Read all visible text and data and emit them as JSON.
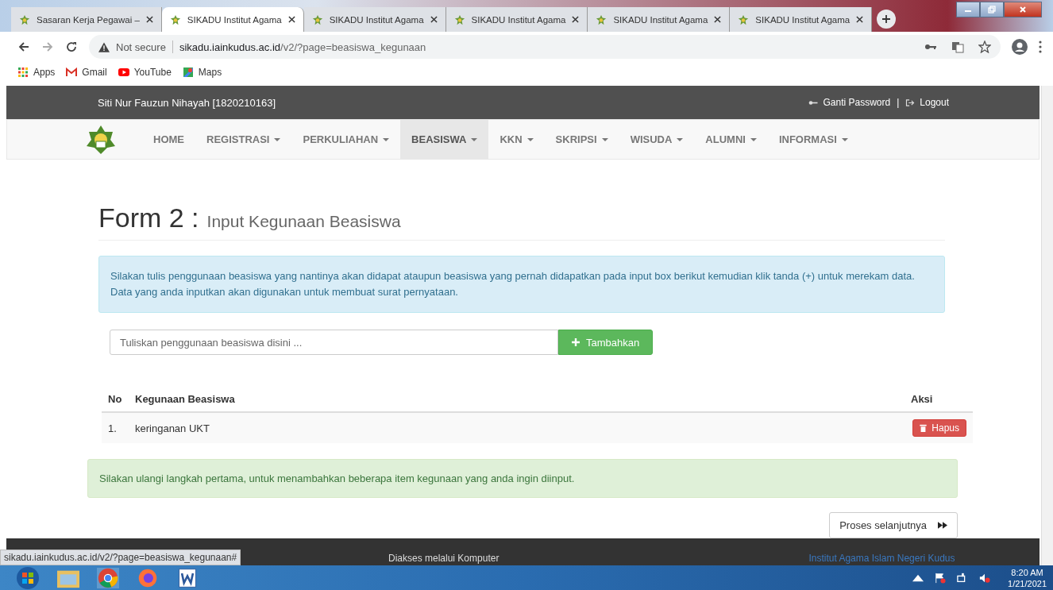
{
  "browser": {
    "tabs": [
      {
        "title": "Sasaran Kerja Pegawai –",
        "selected": false
      },
      {
        "title": "SIKADU Institut Agama",
        "selected": true
      },
      {
        "title": "SIKADU Institut Agama",
        "selected": false
      },
      {
        "title": "SIKADU Institut Agama",
        "selected": false
      },
      {
        "title": "SIKADU Institut Agama",
        "selected": false
      },
      {
        "title": "SIKADU Institut Agama",
        "selected": false
      }
    ],
    "security": "Not secure",
    "url_host": "sikadu.iainkudus.ac.id",
    "url_path": "/v2/?page=beasiswa_kegunaan",
    "bookmarks": [
      {
        "label": "Apps",
        "kind": "apps"
      },
      {
        "label": "Gmail",
        "kind": "gmail"
      },
      {
        "label": "YouTube",
        "kind": "youtube"
      },
      {
        "label": "Maps",
        "kind": "maps"
      }
    ],
    "status_url": "sikadu.iainkudus.ac.id/v2/?page=beasiswa_kegunaan#"
  },
  "header": {
    "user": "Siti Nur Fauzun Nihayah [1820210163]",
    "links": [
      "Ganti Password",
      "Logout"
    ],
    "separator": "|"
  },
  "nav": [
    {
      "label": "HOME",
      "dropdown": false,
      "selected": false
    },
    {
      "label": "REGISTRASI",
      "dropdown": true,
      "selected": false
    },
    {
      "label": "PERKULIAHAN",
      "dropdown": true,
      "selected": false
    },
    {
      "label": "BEASISWA",
      "dropdown": true,
      "selected": true
    },
    {
      "label": "KKN",
      "dropdown": true,
      "selected": false
    },
    {
      "label": "SKRIPSI",
      "dropdown": true,
      "selected": false
    },
    {
      "label": "WISUDA",
      "dropdown": true,
      "selected": false
    },
    {
      "label": "ALUMNI",
      "dropdown": true,
      "selected": false
    },
    {
      "label": "INFORMASI",
      "dropdown": true,
      "selected": false
    }
  ],
  "form": {
    "title": "Form 2 :",
    "subtitle": "Input Kegunaan Beasiswa",
    "info": "Silakan tulis penggunaan beasiswa yang nantinya akan didapat ataupun beasiswa yang pernah didapatkan pada input box berikut kemudian klik tanda (+) untuk merekam data. Data yang anda inputkan akan digunakan untuk membuat surat pernyataan.",
    "input_placeholder": "Tuliskan penggunaan beasiswa disini ...",
    "add_button": "Tambahkan",
    "columns": [
      "No",
      "Kegunaan Beasiswa",
      "Aksi"
    ],
    "rows": [
      {
        "no": "1.",
        "usage": "keringanan UKT",
        "action": "Hapus"
      }
    ],
    "notice": "Silakan ulangi langkah pertama, untuk menambahkan beberapa item kegunaan yang anda ingin diinput.",
    "next_button": "Proses selanjutnya"
  },
  "footer": {
    "left": "Diakses melalui Komputer",
    "right": "Institut Agama Islam Negeri Kudus"
  },
  "taskbar": {
    "time": "8:20 AM",
    "date": "1/21/2021"
  }
}
